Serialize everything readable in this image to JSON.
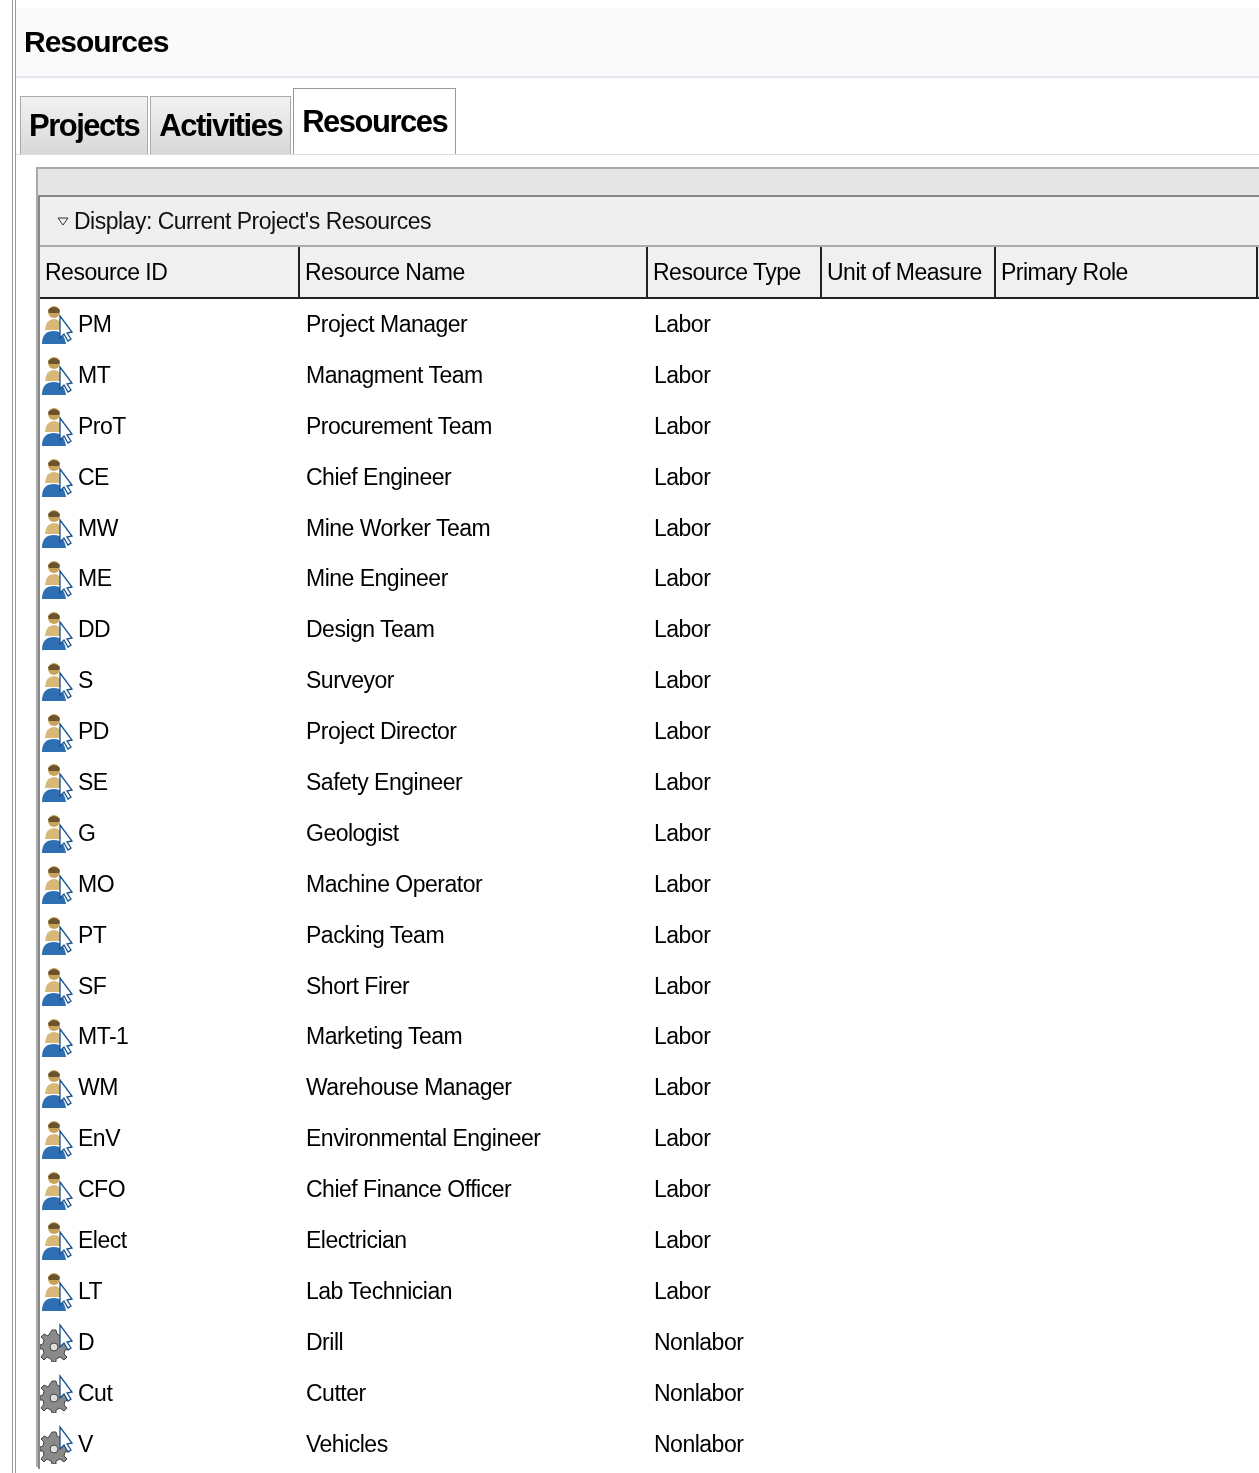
{
  "window": {
    "title": "Resources"
  },
  "tabs": [
    {
      "label": "Projects",
      "selected": false
    },
    {
      "label": "Activities",
      "selected": false
    },
    {
      "label": "Resources",
      "selected": true
    }
  ],
  "filter": {
    "label": "Display: Current Project's Resources",
    "expanded": true
  },
  "table": {
    "columns": [
      "Resource ID",
      "Resource Name",
      "Resource Type",
      "Unit of Measure",
      "Primary Role"
    ],
    "rows": [
      {
        "kind": "labor",
        "id": "PM",
        "name": "Project Manager",
        "type": "Labor"
      },
      {
        "kind": "labor",
        "id": "MT",
        "name": "Managment Team",
        "type": "Labor"
      },
      {
        "kind": "labor",
        "id": "ProT",
        "name": "Procurement Team",
        "type": "Labor"
      },
      {
        "kind": "labor",
        "id": "CE",
        "name": "Chief Engineer",
        "type": "Labor"
      },
      {
        "kind": "labor",
        "id": "MW",
        "name": "Mine Worker Team",
        "type": "Labor"
      },
      {
        "kind": "labor",
        "id": "ME",
        "name": "Mine Engineer",
        "type": "Labor"
      },
      {
        "kind": "labor",
        "id": "DD",
        "name": "Design Team",
        "type": "Labor"
      },
      {
        "kind": "labor",
        "id": "S",
        "name": "Surveyor",
        "type": "Labor"
      },
      {
        "kind": "labor",
        "id": "PD",
        "name": "Project Director",
        "type": "Labor"
      },
      {
        "kind": "labor",
        "id": "SE",
        "name": "Safety Engineer",
        "type": "Labor"
      },
      {
        "kind": "labor",
        "id": "G",
        "name": "Geologist",
        "type": "Labor"
      },
      {
        "kind": "labor",
        "id": "MO",
        "name": "Machine Operator",
        "type": "Labor"
      },
      {
        "kind": "labor",
        "id": "PT",
        "name": "Packing Team",
        "type": "Labor"
      },
      {
        "kind": "labor",
        "id": "SF",
        "name": "Short Firer",
        "type": "Labor"
      },
      {
        "kind": "labor",
        "id": "MT-1",
        "name": "Marketing Team",
        "type": "Labor"
      },
      {
        "kind": "labor",
        "id": "WM",
        "name": "Warehouse Manager",
        "type": "Labor"
      },
      {
        "kind": "labor",
        "id": "EnV",
        "name": "Environmental Engineer",
        "type": "Labor"
      },
      {
        "kind": "labor",
        "id": "CFO",
        "name": "Chief Finance Officer",
        "type": "Labor"
      },
      {
        "kind": "labor",
        "id": "Elect",
        "name": "Electrician",
        "type": "Labor"
      },
      {
        "kind": "labor",
        "id": "LT",
        "name": "Lab Technician",
        "type": "Labor"
      },
      {
        "kind": "nonlabor",
        "id": "D",
        "name": "Drill",
        "type": "Nonlabor"
      },
      {
        "kind": "nonlabor",
        "id": "Cut",
        "name": "Cutter",
        "type": "Nonlabor"
      },
      {
        "kind": "nonlabor",
        "id": "V",
        "name": "Vehicles",
        "type": "Nonlabor"
      }
    ]
  }
}
